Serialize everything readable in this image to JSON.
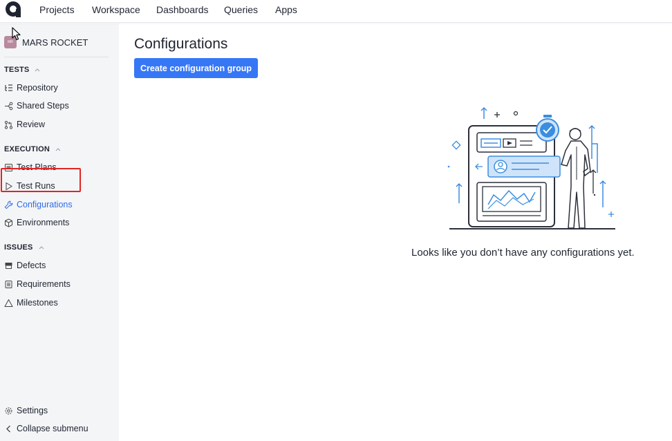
{
  "topnav": {
    "logo_icon": "app-logo-icon",
    "items": [
      "Projects",
      "Workspace",
      "Dashboards",
      "Queries",
      "Apps"
    ]
  },
  "sidebar": {
    "project": {
      "avatar": "MR",
      "name": "MARS ROCKET"
    },
    "sections": {
      "tests": "TESTS",
      "execution": "EXECUTION",
      "issues": "ISSUES"
    },
    "items": {
      "repository": "Repository",
      "shared_steps": "Shared Steps",
      "review": "Review",
      "test_plans": "Test Plans",
      "test_runs": "Test Runs",
      "configurations": "Configurations",
      "environments": "Environments",
      "defects": "Defects",
      "requirements": "Requirements",
      "milestones": "Milestones",
      "settings": "Settings",
      "collapse": "Collapse submenu"
    }
  },
  "main": {
    "title": "Configurations",
    "create_button": "Create configuration group",
    "empty_message": "Looks like you don’t have any configurations yet."
  },
  "colors": {
    "accent": "#3677f6",
    "active_link": "#2e6be6",
    "highlight": "#e02424",
    "sidebar_bg": "#f4f5f7"
  }
}
